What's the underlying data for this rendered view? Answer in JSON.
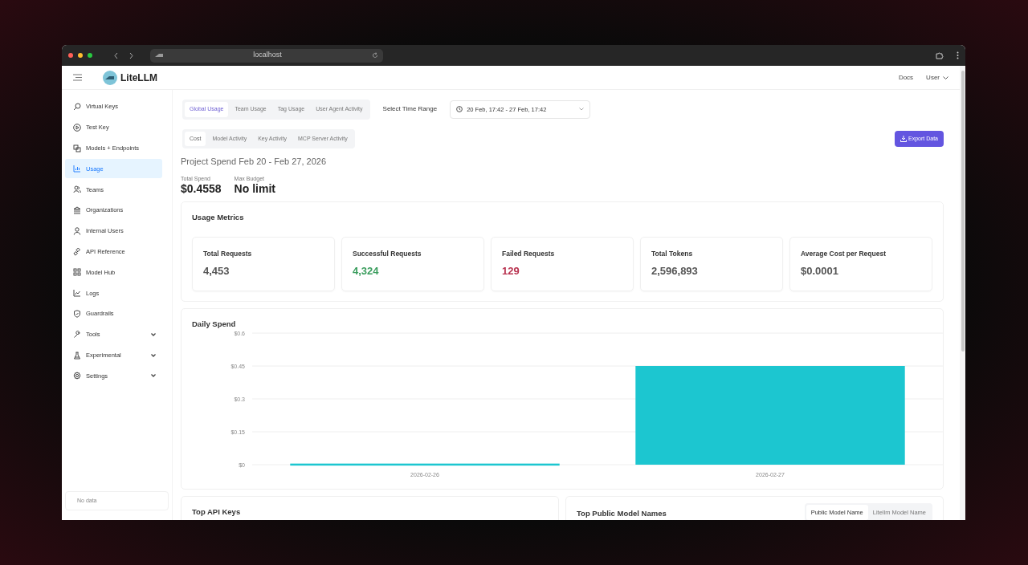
{
  "browser": {
    "address": "localhost"
  },
  "header": {
    "brand": "LiteLLM",
    "links": [
      "Docs",
      "User"
    ]
  },
  "sidebar": {
    "items": [
      {
        "label": "Virtual Keys",
        "selected": false,
        "collapsible": false
      },
      {
        "label": "Test Key",
        "selected": false,
        "collapsible": false
      },
      {
        "label": "Models + Endpoints",
        "selected": false,
        "collapsible": false
      },
      {
        "label": "Usage",
        "selected": true,
        "collapsible": false
      },
      {
        "label": "Teams",
        "selected": false,
        "collapsible": false
      },
      {
        "label": "Organizations",
        "selected": false,
        "collapsible": false
      },
      {
        "label": "Internal Users",
        "selected": false,
        "collapsible": false
      },
      {
        "label": "API Reference",
        "selected": false,
        "collapsible": false
      },
      {
        "label": "Model Hub",
        "selected": false,
        "collapsible": false
      },
      {
        "label": "Logs",
        "selected": false,
        "collapsible": false
      },
      {
        "label": "Guardrails",
        "selected": false,
        "collapsible": false
      },
      {
        "label": "Tools",
        "selected": false,
        "collapsible": true
      },
      {
        "label": "Experimental",
        "selected": false,
        "collapsible": true
      },
      {
        "label": "Settings",
        "selected": false,
        "collapsible": true
      }
    ],
    "footer": "No data"
  },
  "usage_tabs": [
    {
      "label": "Global Usage",
      "selected": true
    },
    {
      "label": "Team Usage",
      "selected": false
    },
    {
      "label": "Tag Usage",
      "selected": false
    },
    {
      "label": "User Agent Activity",
      "selected": false
    }
  ],
  "time_range": {
    "label": "Select Time Range",
    "value": "20 Feb, 17:42 - 27 Feb, 17:42"
  },
  "view_tabs": [
    {
      "label": "Cost",
      "selected": true
    },
    {
      "label": "Model Activity",
      "selected": false
    },
    {
      "label": "Key Activity",
      "selected": false
    },
    {
      "label": "MCP Server Activity",
      "selected": false
    }
  ],
  "export_button": "Export Data",
  "project_spend": {
    "title": "Project Spend Feb 20 - Feb 27, 2026",
    "total_spend_label": "Total Spend",
    "total_spend": "$0.4558",
    "max_budget_label": "Max Budget",
    "max_budget": "No limit"
  },
  "usage_metrics": {
    "title": "Usage Metrics",
    "cards": [
      {
        "label": "Total Requests",
        "value": "4,453",
        "color": "#555555"
      },
      {
        "label": "Successful Requests",
        "value": "4,324",
        "color": "#3a9d5d"
      },
      {
        "label": "Failed Requests",
        "value": "129",
        "color": "#b8324f"
      },
      {
        "label": "Total Tokens",
        "value": "2,596,893",
        "color": "#555555"
      },
      {
        "label": "Average Cost per Request",
        "value": "$0.0001",
        "color": "#555555"
      }
    ]
  },
  "daily_spend": {
    "title": "Daily Spend",
    "chart_data": {
      "type": "bar",
      "categories": [
        "2026-02-26",
        "2026-02-27"
      ],
      "series": [
        {
          "color": "#1cc6d0",
          "values": [
            0.005,
            0.45
          ]
        }
      ],
      "grid": true,
      "ylim": [
        0,
        0.6
      ],
      "yticks": [
        {
          "value": 0,
          "label": "$0"
        },
        {
          "value": 0.15,
          "label": "$0.15"
        },
        {
          "value": 0.3,
          "label": "$0.3"
        },
        {
          "value": 0.45,
          "label": "$0.45"
        },
        {
          "value": 0.6,
          "label": "$0.6"
        }
      ]
    }
  },
  "top_api_keys": {
    "title": "Top API Keys"
  },
  "top_models": {
    "title": "Top Public Model Names",
    "toggle": [
      {
        "label": "Public Model Name",
        "selected": true
      },
      {
        "label": "Litellm Model Name",
        "selected": false
      }
    ]
  }
}
